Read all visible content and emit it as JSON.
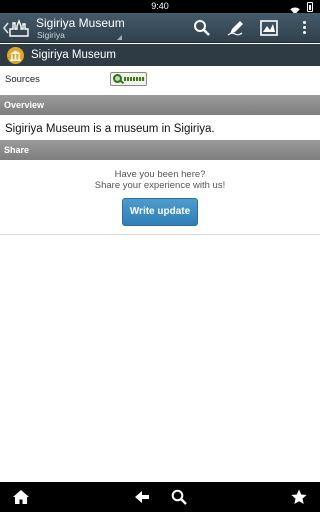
{
  "status_bar": {
    "time": "9:40"
  },
  "header": {
    "title": "Sigiriya Museum",
    "subtitle": "Sigiriya"
  },
  "place": {
    "title": "Sigiriya Museum"
  },
  "sources": {
    "label": "Sources"
  },
  "overview": {
    "heading": "Overview",
    "text": "Sigiriya Museum is a museum in Sigiriya."
  },
  "share": {
    "heading": "Share",
    "prompt_line1": "Have you been here?",
    "prompt_line2": "Share your experience with us!",
    "button_label": "Write update"
  },
  "colors": {
    "action_bar": "#3c4d5a",
    "place_bar": "#2e3b45",
    "place_icon": "#e2a522",
    "section_header": "#8c8c8c",
    "button": "#3d8dc4"
  },
  "icons": {
    "app_logo": "city-skyline-icon",
    "search": "search-icon",
    "edit": "pen-icon",
    "map": "map-icon",
    "overflow": "overflow-menu-icon",
    "place": "museum-icon",
    "source": "source-logo-icon",
    "home": "home-icon",
    "back": "back-arrow-icon",
    "nav_search": "search-icon",
    "favorite": "star-icon"
  }
}
